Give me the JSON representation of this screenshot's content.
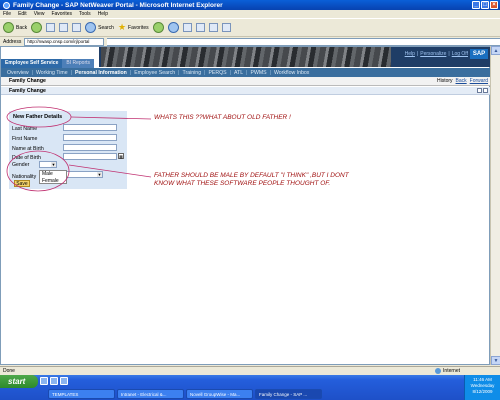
{
  "window": {
    "title": "Family Change - SAP NetWeaver Portal - Microsoft Internet Explorer"
  },
  "menu": [
    "File",
    "Edit",
    "View",
    "Favorites",
    "Tools",
    "Help"
  ],
  "toolbar": {
    "back": "Back",
    "search": "Search",
    "favorites": "Favorites"
  },
  "address": {
    "label": "Address",
    "url": "http://nwasp.cnsp.com/irj/portal"
  },
  "portal": {
    "header_links": [
      "Help",
      "Personalize",
      "Log Off"
    ],
    "logo": "SAP",
    "tabs": [
      "Employee Self Service",
      "BI Reports"
    ],
    "nav": [
      "Overview",
      "Working Time",
      "Personal Information",
      "Employee Search",
      "Training",
      "PERQS",
      "ATL",
      "PWMS",
      "Workflow Inbox"
    ],
    "nav_selected": "Personal Information",
    "page_title": "Family Change",
    "history": [
      "History",
      "Back",
      "Forward"
    ],
    "iview_title": "Family Change"
  },
  "form": {
    "title": "New Father Details",
    "fields": [
      "Last Name",
      "First Name",
      "Name at Birth",
      "Date of Birth",
      "Gender",
      "Nationality"
    ],
    "gender_options": [
      "Male",
      "Female"
    ],
    "save": "Save"
  },
  "annotations": {
    "first": "WHATS THIS ??WHAT ABOUT OLD FATHER !",
    "second_line1": "FATHER SHOULD BE MALE BY DEFAULT \"I THINK\" ,BUT I DONT",
    "second_line2": "KNOW WHAT THESE SOFTWARE PEOPLE THOUGHT OF."
  },
  "status": {
    "text": "Done",
    "zone": "Internet"
  },
  "taskbar": {
    "start": "start",
    "tasks": [
      "TEMPLATES",
      "Intranet - Electrical &...",
      "Novell GroupWise - Ma...",
      "Family Change - SAP ..."
    ],
    "time": "11:46 AM",
    "day": "Wednesday",
    "date": "8/12/2009"
  },
  "colors": {
    "annotation": "#a01010",
    "portal_nav": "#3a6e9e",
    "form_bg": "#d9e6f5"
  }
}
